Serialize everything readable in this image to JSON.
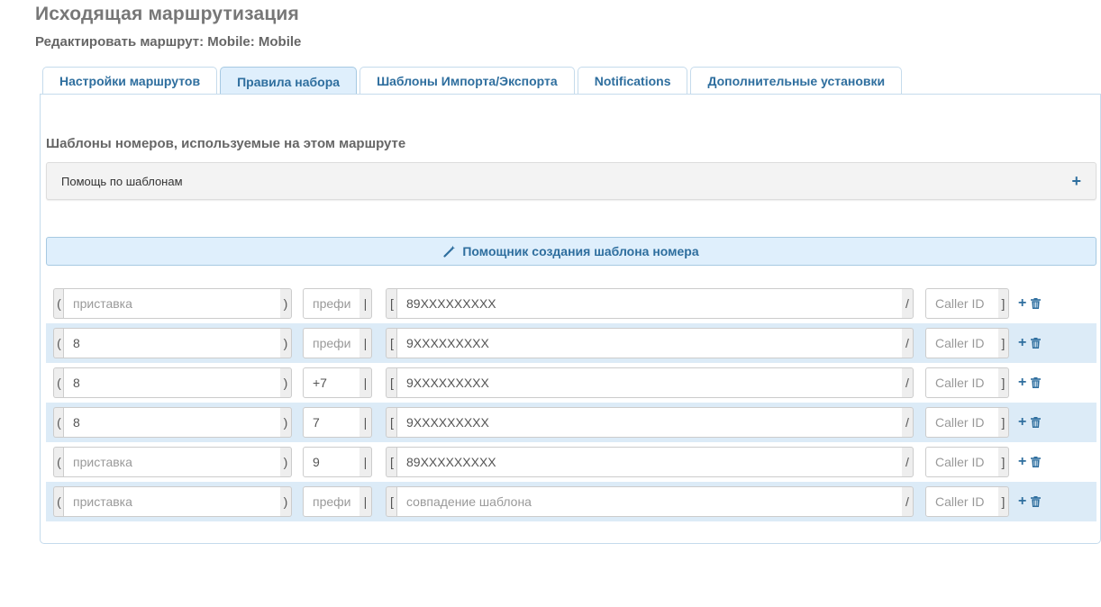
{
  "header": {
    "title": "Исходящая маршрутизация",
    "subtitle": "Редактировать маршрут: Mobile: Mobile"
  },
  "tabs": [
    {
      "label": "Настройки маршрутов",
      "active": false
    },
    {
      "label": "Правила набора",
      "active": true
    },
    {
      "label": "Шаблоны Импорта/Экспорта",
      "active": false
    },
    {
      "label": "Notifications",
      "active": false
    },
    {
      "label": "Дополнительные установки",
      "active": false
    }
  ],
  "section": {
    "heading": "Шаблоны номеров, используемые на этом маршруте",
    "help_label": "Помощь по шаблонам",
    "wizard_label": "Помощник создания шаблона номера"
  },
  "placeholders": {
    "prepend": "приставка",
    "prefix": "префикс",
    "match": "совпадение шаблона",
    "callerid": "Caller ID"
  },
  "symbols": {
    "open_paren": "(",
    "close_paren": ")",
    "pipe": "|",
    "open_bracket": "[",
    "slash": "/",
    "close_bracket": "]"
  },
  "rows": [
    {
      "prepend": "",
      "prefix": "",
      "match": "89XXXXXXXXX",
      "callerid": ""
    },
    {
      "prepend": "8",
      "prefix": "",
      "match": "9XXXXXXXXX",
      "callerid": ""
    },
    {
      "prepend": "8",
      "prefix": "+7",
      "match": "9XXXXXXXXX",
      "callerid": ""
    },
    {
      "prepend": "8",
      "prefix": "7",
      "match": "9XXXXXXXXX",
      "callerid": ""
    },
    {
      "prepend": "",
      "prefix": "9",
      "match": "89XXXXXXXXX",
      "callerid": ""
    },
    {
      "prepend": "",
      "prefix": "",
      "match": "",
      "callerid": ""
    }
  ],
  "colors": {
    "accent": "#2e6e9e",
    "row_alt": "#dcebf7",
    "wizard_bg": "#dfeffc"
  },
  "icons": {
    "add": "plus-icon",
    "remove": "trash-icon",
    "wizard": "magic-wand-icon",
    "expand": "plus-icon"
  }
}
